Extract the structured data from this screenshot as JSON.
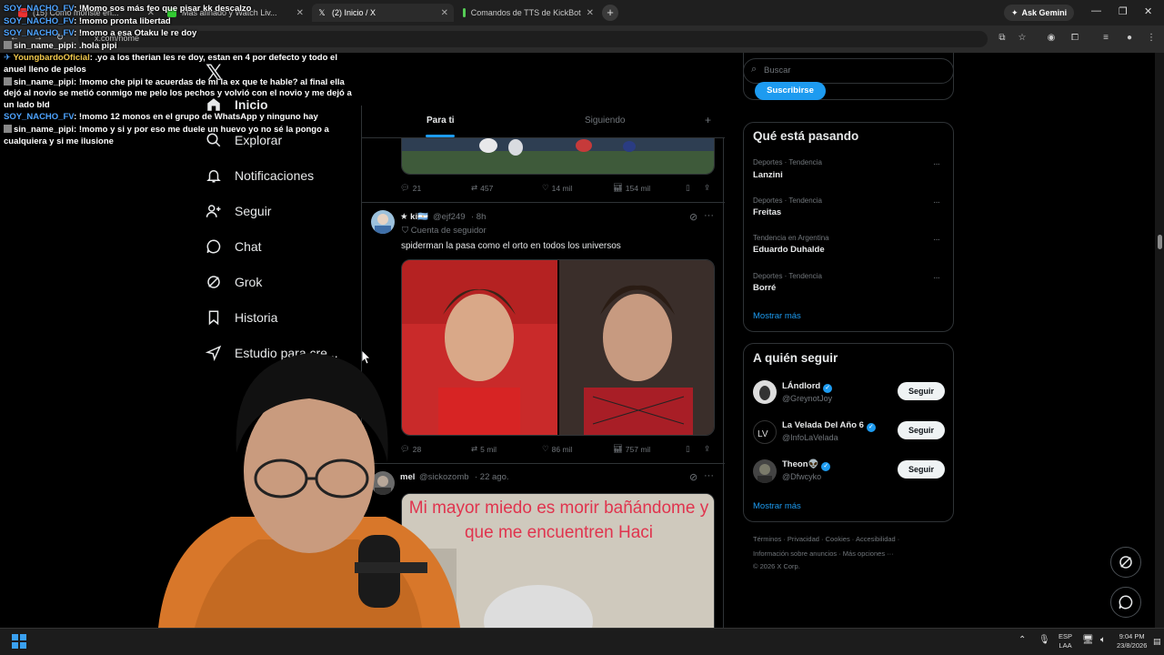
{
  "browser": {
    "tabs": [
      {
        "label": "(15) Cómo moriste en..."
      },
      {
        "label": "Mas afinado y Watch Liv..."
      },
      {
        "label": "(2) Inicio / X"
      },
      {
        "label": "Comandos de TTS de KickBot"
      }
    ],
    "ask_gemini": "Ask Gemini",
    "url": "x.com/home"
  },
  "chat": [
    {
      "user": "SOY_NACHO_FV",
      "text": "!Momo sos más feo que pisar kk descalzo",
      "color": "blue"
    },
    {
      "user": "SOY_NACHO_FV",
      "text": "!momo pronta libertad",
      "color": "blue"
    },
    {
      "user": "SOY_NACHO_FV",
      "text": "!momo a esa Otaku le re doy",
      "color": "blue"
    },
    {
      "user": "sin_name_pipi",
      "text": ".hola pipi",
      "color": "white"
    },
    {
      "user": "YoungbardoOficial",
      "text": ".yo a los therian les re doy, estan en 4 por defecto y todo el anuel lleno de pelos",
      "color": "gold"
    },
    {
      "user": "sin_name_pipi",
      "text": "!momo che pipi te acuerdas de mi la ex que te hable? al final ella dejó al novio se metió conmigo me pelo los pechos y volvió con el novio y me dejó a un lado bld",
      "color": "white"
    },
    {
      "user": "SOY_NACHO_FV",
      "text": "!momo 12 monos en el grupo de WhatsApp y ninguno hay",
      "color": "blue"
    },
    {
      "user": "sin_name_pipi",
      "text": "!momo y si y por eso me duele un huevo yo no sé la pongo a cualquiera y si me ilusione",
      "color": "white"
    }
  ],
  "nav": {
    "inicio": "Inicio",
    "explorar": "Explorar",
    "notificaciones": "Notificaciones",
    "seguir": "Seguir",
    "chat": "Chat",
    "grok": "Grok",
    "historia": "Historia",
    "estudio": "Estudio para cre..."
  },
  "feed": {
    "tab_para_ti": "Para ti",
    "tab_siguiendo": "Siguiendo",
    "post1": {
      "replies": "21",
      "reposts": "457",
      "likes": "14 mil",
      "views": "154 mil"
    },
    "post2": {
      "name": "★ ki🇦🇷",
      "handle": "@ejf249",
      "time": "· 8h",
      "follower_note": "Cuenta de seguidor",
      "text": "spiderman la pasa como el orto en todos los universos",
      "replies": "28",
      "reposts": "5 mil",
      "likes": "86 mil",
      "views": "757 mil"
    },
    "post3": {
      "name": "mel",
      "handle": "@sickozomb",
      "time": "· 22 ago.",
      "image_caption": "Mi mayor miedo es morir bañándome y que me encuentren Haci"
    }
  },
  "right": {
    "search_placeholder": "Buscar",
    "subscribe": "Suscribirse",
    "trending_title": "Qué está pasando",
    "trends": [
      {
        "category": "Deportes · Tendencia",
        "name": "Lanzini"
      },
      {
        "category": "Deportes · Tendencia",
        "name": "Freitas"
      },
      {
        "category": "Tendencia en Argentina",
        "name": "Eduardo Duhalde"
      },
      {
        "category": "Deportes · Tendencia",
        "name": "Borré"
      }
    ],
    "show_more": "Mostrar más",
    "who_to_follow_title": "A quién seguir",
    "follow": [
      {
        "name": "LÁndlord",
        "handle": "@GreynotJoy"
      },
      {
        "name": "La Velada Del Año 6",
        "handle": "@InfoLaVelada"
      },
      {
        "name": "Theon👽",
        "handle": "@Dfwcyko"
      }
    ],
    "follow_btn": "Seguir",
    "footer1": "Términos  ·  Privacidad  ·  Cookies  ·  Accesibilidad  ·",
    "footer2": "Información sobre anuncios  ·  Más opciones ···",
    "footer3": "© 2026 X Corp."
  },
  "taskbar": {
    "lang1": "ESP",
    "lang2": "LAA",
    "time": "9:04 PM",
    "date": "23/8/2026"
  },
  "colors": {
    "accent": "#1d9bf0",
    "bg": "#000000",
    "border": "#2f3336",
    "muted": "#71767b"
  }
}
